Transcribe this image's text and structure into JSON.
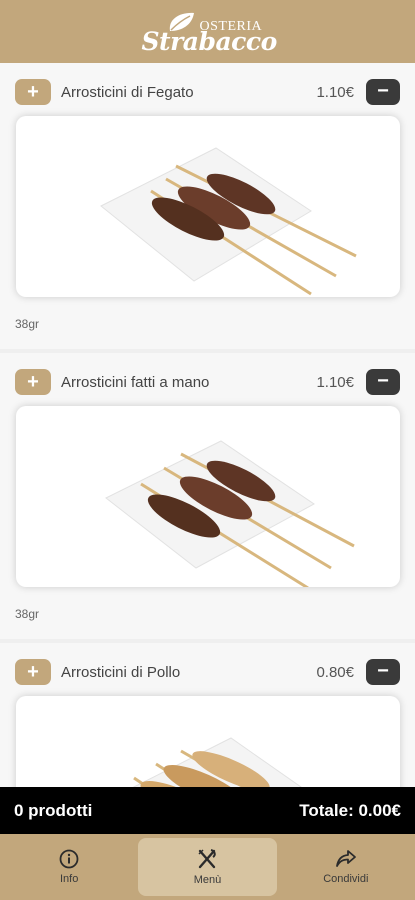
{
  "header": {
    "brand_top": "OSTERIA",
    "brand_script": "Strabacco"
  },
  "items": [
    {
      "name": "Arrosticini di Fegato",
      "price": "1.10€",
      "weight": "38gr",
      "add_label": "+",
      "remove_label": "−"
    },
    {
      "name": "Arrosticini fatti a mano",
      "price": "1.10€",
      "weight": "38gr",
      "add_label": "+",
      "remove_label": "−"
    },
    {
      "name": "Arrosticini di Pollo",
      "price": "0.80€",
      "weight": "",
      "add_label": "+",
      "remove_label": "−"
    }
  ],
  "cart": {
    "count_label": "0 prodotti",
    "total_label": "Totale: 0.00€"
  },
  "nav": [
    {
      "label": "Info",
      "icon": "info-icon"
    },
    {
      "label": "Menù",
      "icon": "cutlery-icon",
      "active": true
    },
    {
      "label": "Condividi",
      "icon": "share-icon"
    }
  ],
  "colors": {
    "brand": "#c2a77c",
    "dark_button": "#3a3a3a",
    "cart_bar": "#000000"
  }
}
